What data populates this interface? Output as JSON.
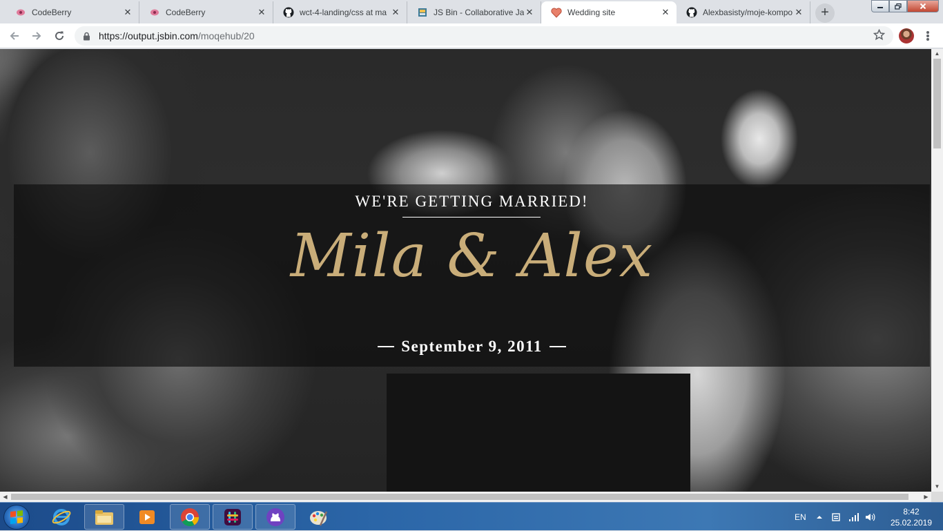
{
  "browser": {
    "tabs": [
      {
        "title": "CodeBerry",
        "icon": "codeberry-icon",
        "active": false
      },
      {
        "title": "CodeBerry",
        "icon": "codeberry-icon",
        "active": false
      },
      {
        "title": "wct-4-landing/css at ma",
        "icon": "github-icon",
        "active": false
      },
      {
        "title": "JS Bin - Collaborative Ja",
        "icon": "jsbin-icon",
        "active": false
      },
      {
        "title": "Wedding site",
        "icon": "heart-icon",
        "active": true
      },
      {
        "title": "Alexbasisty/moje-kompo",
        "icon": "github-icon",
        "active": false
      }
    ],
    "new_tab_label": "+",
    "close_glyph": "✕",
    "url_host": "https://output.jsbin.com",
    "url_path": "/moqehub/20"
  },
  "hero": {
    "tagline": "WE'RE GETTING MARRIED!",
    "names": "Mila & Alex",
    "date": "September 9, 2011",
    "accent_color": "#c9ad79"
  },
  "taskbar": {
    "apps": [
      "internet-explorer-icon",
      "file-explorer-icon",
      "media-player-icon",
      "chrome-icon",
      "slack-icon",
      "github-desktop-icon",
      "paint-icon"
    ],
    "language": "EN",
    "time": "8:42",
    "date": "25.02.2019"
  }
}
